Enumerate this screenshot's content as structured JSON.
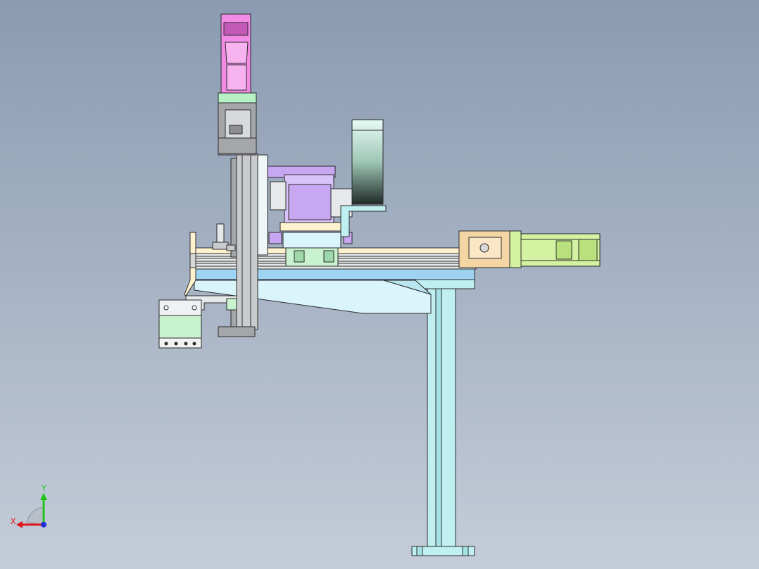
{
  "viewport": {
    "background_top": "#8a9bb2",
    "background_bottom": "#c4ccd8"
  },
  "triad": {
    "x_label": "X",
    "y_label": "Y",
    "x_color": "#e0161b",
    "y_color": "#21c21c",
    "z_color": "#1d2fd6"
  },
  "part_colors": {
    "motor_pink": "#f28be6",
    "motor_pink_dark": "#c45ab8",
    "coupling_green": "#b6f0c4",
    "frame_gray": "#a4a6a8",
    "purple": "#c7a6f2",
    "purple_dark": "#9b7ccf",
    "cyan": "#bfeff0",
    "light_blue": "#d9f4fb",
    "blue_band": "#9fd3f2",
    "cream": "#fff3cf",
    "tan": "#f4d6a4",
    "lime": "#d4f3a2",
    "gripper_green": "#c9f2cf"
  }
}
